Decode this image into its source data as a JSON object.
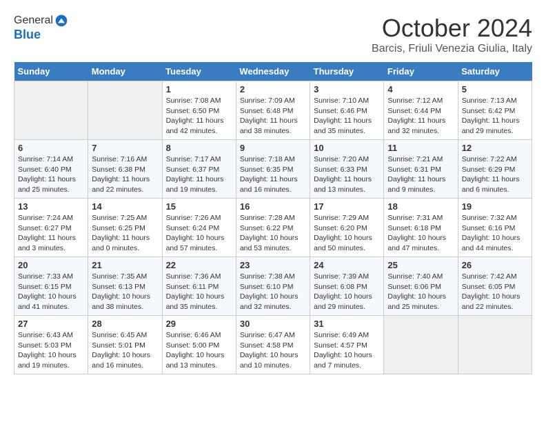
{
  "header": {
    "logo_line1": "General",
    "logo_line2": "Blue",
    "month": "October 2024",
    "location": "Barcis, Friuli Venezia Giulia, Italy"
  },
  "weekdays": [
    "Sunday",
    "Monday",
    "Tuesday",
    "Wednesday",
    "Thursday",
    "Friday",
    "Saturday"
  ],
  "weeks": [
    [
      {
        "day": "",
        "empty": true
      },
      {
        "day": "",
        "empty": true
      },
      {
        "day": "1",
        "sunrise": "Sunrise: 7:08 AM",
        "sunset": "Sunset: 6:50 PM",
        "daylight": "Daylight: 11 hours and 42 minutes."
      },
      {
        "day": "2",
        "sunrise": "Sunrise: 7:09 AM",
        "sunset": "Sunset: 6:48 PM",
        "daylight": "Daylight: 11 hours and 38 minutes."
      },
      {
        "day": "3",
        "sunrise": "Sunrise: 7:10 AM",
        "sunset": "Sunset: 6:46 PM",
        "daylight": "Daylight: 11 hours and 35 minutes."
      },
      {
        "day": "4",
        "sunrise": "Sunrise: 7:12 AM",
        "sunset": "Sunset: 6:44 PM",
        "daylight": "Daylight: 11 hours and 32 minutes."
      },
      {
        "day": "5",
        "sunrise": "Sunrise: 7:13 AM",
        "sunset": "Sunset: 6:42 PM",
        "daylight": "Daylight: 11 hours and 29 minutes."
      }
    ],
    [
      {
        "day": "6",
        "sunrise": "Sunrise: 7:14 AM",
        "sunset": "Sunset: 6:40 PM",
        "daylight": "Daylight: 11 hours and 25 minutes."
      },
      {
        "day": "7",
        "sunrise": "Sunrise: 7:16 AM",
        "sunset": "Sunset: 6:38 PM",
        "daylight": "Daylight: 11 hours and 22 minutes."
      },
      {
        "day": "8",
        "sunrise": "Sunrise: 7:17 AM",
        "sunset": "Sunset: 6:37 PM",
        "daylight": "Daylight: 11 hours and 19 minutes."
      },
      {
        "day": "9",
        "sunrise": "Sunrise: 7:18 AM",
        "sunset": "Sunset: 6:35 PM",
        "daylight": "Daylight: 11 hours and 16 minutes."
      },
      {
        "day": "10",
        "sunrise": "Sunrise: 7:20 AM",
        "sunset": "Sunset: 6:33 PM",
        "daylight": "Daylight: 11 hours and 13 minutes."
      },
      {
        "day": "11",
        "sunrise": "Sunrise: 7:21 AM",
        "sunset": "Sunset: 6:31 PM",
        "daylight": "Daylight: 11 hours and 9 minutes."
      },
      {
        "day": "12",
        "sunrise": "Sunrise: 7:22 AM",
        "sunset": "Sunset: 6:29 PM",
        "daylight": "Daylight: 11 hours and 6 minutes."
      }
    ],
    [
      {
        "day": "13",
        "sunrise": "Sunrise: 7:24 AM",
        "sunset": "Sunset: 6:27 PM",
        "daylight": "Daylight: 11 hours and 3 minutes."
      },
      {
        "day": "14",
        "sunrise": "Sunrise: 7:25 AM",
        "sunset": "Sunset: 6:25 PM",
        "daylight": "Daylight: 11 hours and 0 minutes."
      },
      {
        "day": "15",
        "sunrise": "Sunrise: 7:26 AM",
        "sunset": "Sunset: 6:24 PM",
        "daylight": "Daylight: 10 hours and 57 minutes."
      },
      {
        "day": "16",
        "sunrise": "Sunrise: 7:28 AM",
        "sunset": "Sunset: 6:22 PM",
        "daylight": "Daylight: 10 hours and 53 minutes."
      },
      {
        "day": "17",
        "sunrise": "Sunrise: 7:29 AM",
        "sunset": "Sunset: 6:20 PM",
        "daylight": "Daylight: 10 hours and 50 minutes."
      },
      {
        "day": "18",
        "sunrise": "Sunrise: 7:31 AM",
        "sunset": "Sunset: 6:18 PM",
        "daylight": "Daylight: 10 hours and 47 minutes."
      },
      {
        "day": "19",
        "sunrise": "Sunrise: 7:32 AM",
        "sunset": "Sunset: 6:16 PM",
        "daylight": "Daylight: 10 hours and 44 minutes."
      }
    ],
    [
      {
        "day": "20",
        "sunrise": "Sunrise: 7:33 AM",
        "sunset": "Sunset: 6:15 PM",
        "daylight": "Daylight: 10 hours and 41 minutes."
      },
      {
        "day": "21",
        "sunrise": "Sunrise: 7:35 AM",
        "sunset": "Sunset: 6:13 PM",
        "daylight": "Daylight: 10 hours and 38 minutes."
      },
      {
        "day": "22",
        "sunrise": "Sunrise: 7:36 AM",
        "sunset": "Sunset: 6:11 PM",
        "daylight": "Daylight: 10 hours and 35 minutes."
      },
      {
        "day": "23",
        "sunrise": "Sunrise: 7:38 AM",
        "sunset": "Sunset: 6:10 PM",
        "daylight": "Daylight: 10 hours and 32 minutes."
      },
      {
        "day": "24",
        "sunrise": "Sunrise: 7:39 AM",
        "sunset": "Sunset: 6:08 PM",
        "daylight": "Daylight: 10 hours and 29 minutes."
      },
      {
        "day": "25",
        "sunrise": "Sunrise: 7:40 AM",
        "sunset": "Sunset: 6:06 PM",
        "daylight": "Daylight: 10 hours and 25 minutes."
      },
      {
        "day": "26",
        "sunrise": "Sunrise: 7:42 AM",
        "sunset": "Sunset: 6:05 PM",
        "daylight": "Daylight: 10 hours and 22 minutes."
      }
    ],
    [
      {
        "day": "27",
        "sunrise": "Sunrise: 6:43 AM",
        "sunset": "Sunset: 5:03 PM",
        "daylight": "Daylight: 10 hours and 19 minutes."
      },
      {
        "day": "28",
        "sunrise": "Sunrise: 6:45 AM",
        "sunset": "Sunset: 5:01 PM",
        "daylight": "Daylight: 10 hours and 16 minutes."
      },
      {
        "day": "29",
        "sunrise": "Sunrise: 6:46 AM",
        "sunset": "Sunset: 5:00 PM",
        "daylight": "Daylight: 10 hours and 13 minutes."
      },
      {
        "day": "30",
        "sunrise": "Sunrise: 6:47 AM",
        "sunset": "Sunset: 4:58 PM",
        "daylight": "Daylight: 10 hours and 10 minutes."
      },
      {
        "day": "31",
        "sunrise": "Sunrise: 6:49 AM",
        "sunset": "Sunset: 4:57 PM",
        "daylight": "Daylight: 10 hours and 7 minutes."
      },
      {
        "day": "",
        "empty": true
      },
      {
        "day": "",
        "empty": true
      }
    ]
  ]
}
